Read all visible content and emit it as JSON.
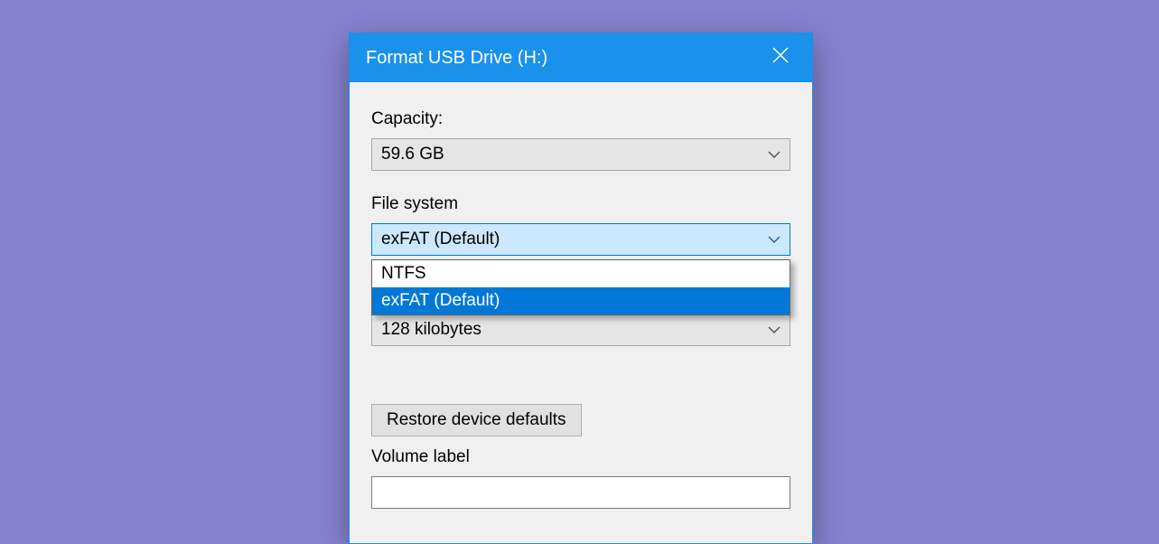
{
  "title": "Format USB Drive (H:)",
  "capacity_label": "Capacity:",
  "capacity_value": "59.6 GB",
  "filesystem_label": "File system",
  "filesystem_value": "exFAT (Default)",
  "filesystem_options": [
    {
      "label": "NTFS",
      "selected": false
    },
    {
      "label": "exFAT (Default)",
      "selected": true
    }
  ],
  "allocation_value": "128 kilobytes",
  "restore_button": "Restore device defaults",
  "volume_label": "Volume label",
  "volume_value": ""
}
